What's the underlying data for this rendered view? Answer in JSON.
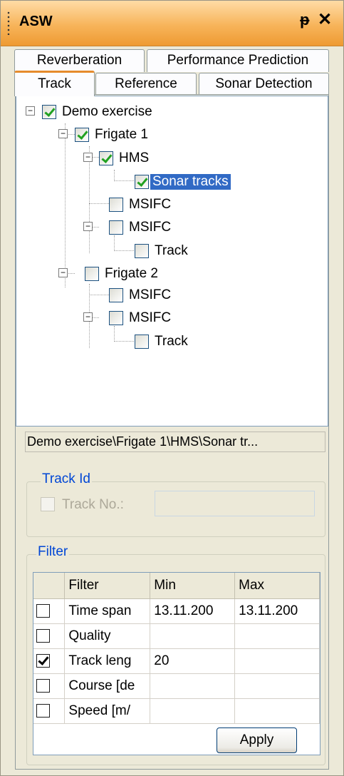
{
  "window": {
    "title": "ASW",
    "pin_glyph": "ᵽ",
    "close_glyph": "✕"
  },
  "tabs_row1": [
    {
      "label": "Reverberation"
    },
    {
      "label": "Performance Prediction"
    }
  ],
  "tabs_row2": [
    {
      "label": "Track",
      "active": true
    },
    {
      "label": "Reference"
    },
    {
      "label": "Sonar Detection"
    }
  ],
  "tree": {
    "nodes": [
      {
        "label": "Demo exercise",
        "checked": true
      },
      {
        "label": "Frigate 1",
        "checked": true
      },
      {
        "label": "HMS",
        "checked": true
      },
      {
        "label": "Sonar tracks",
        "checked": true,
        "selected": true
      },
      {
        "label": "MSIFC",
        "checked": false
      },
      {
        "label": "MSIFC",
        "checked": false
      },
      {
        "label": "Track",
        "checked": false
      },
      {
        "label": "Frigate 2",
        "checked": false
      },
      {
        "label": "MSIFC",
        "checked": false
      },
      {
        "label": "MSIFC",
        "checked": false
      },
      {
        "label": "Track",
        "checked": false
      }
    ]
  },
  "path": "Demo exercise\\Frigate 1\\HMS\\Sonar tr...",
  "track_id": {
    "legend": "Track Id",
    "checkbox_label": "Track No.:",
    "value": ""
  },
  "filter": {
    "legend": "Filter",
    "columns": [
      "Filter",
      "Min",
      "Max"
    ],
    "rows": [
      {
        "checked": false,
        "filter": "Time span",
        "min": "13.11.200",
        "max": "13.11.200"
      },
      {
        "checked": false,
        "filter": "Quality",
        "min": "",
        "max": ""
      },
      {
        "checked": true,
        "filter": "Track leng",
        "min": "20",
        "max": ""
      },
      {
        "checked": false,
        "filter": "Course [de",
        "min": "",
        "max": ""
      },
      {
        "checked": false,
        "filter": "Speed [m/",
        "min": "",
        "max": ""
      }
    ],
    "apply_label": "Apply"
  }
}
